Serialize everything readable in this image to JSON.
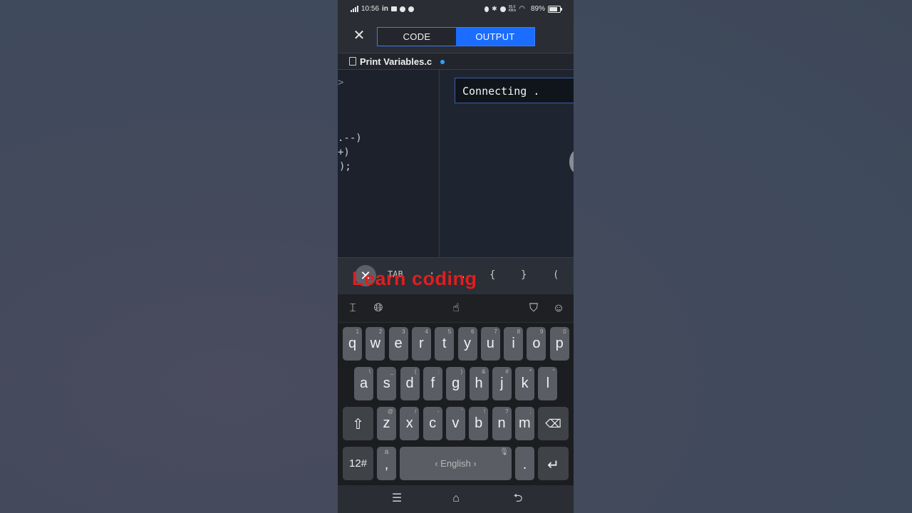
{
  "status_bar": {
    "time": "10:56",
    "app_badge": "in",
    "net_speed_top": "55.0",
    "net_speed_bottom": "KB/s",
    "battery": "89%"
  },
  "header": {
    "close_icon": "close-icon",
    "tabs": [
      {
        "label": "CODE",
        "active": false
      },
      {
        "label": "OUTPUT",
        "active": true
      }
    ]
  },
  "file": {
    "name": "Print Variables.c",
    "modified_dot_color": "#2aa4ff"
  },
  "code_pane": {
    "lines": [
      ">",
      ".--)",
      "+)",
      ");"
    ]
  },
  "output_pane": {
    "text": "Connecting ."
  },
  "helper_bar": {
    "keys": [
      "TAB",
      ";",
      ".",
      "{",
      "}",
      "("
    ],
    "overlay_caption": "Learn coding"
  },
  "keyboard": {
    "row1": [
      {
        "key": "q",
        "hint": "1"
      },
      {
        "key": "w",
        "hint": "2"
      },
      {
        "key": "e",
        "hint": "3"
      },
      {
        "key": "r",
        "hint": "4"
      },
      {
        "key": "t",
        "hint": "5"
      },
      {
        "key": "y",
        "hint": "6"
      },
      {
        "key": "u",
        "hint": "7"
      },
      {
        "key": "i",
        "hint": "8"
      },
      {
        "key": "o",
        "hint": "9"
      },
      {
        "key": "p",
        "hint": "0"
      }
    ],
    "row2": [
      {
        "key": "a",
        "hint": "\\"
      },
      {
        "key": "s",
        "hint": "_"
      },
      {
        "key": "d",
        "hint": "("
      },
      {
        "key": "f",
        "hint": ":"
      },
      {
        "key": "g",
        "hint": ")"
      },
      {
        "key": "h",
        "hint": "&"
      },
      {
        "key": "j",
        "hint": "#"
      },
      {
        "key": "k",
        "hint": "*"
      },
      {
        "key": "l",
        "hint": "\""
      }
    ],
    "row3": [
      {
        "key": "z",
        "hint": "@"
      },
      {
        "key": "x",
        "hint": "/"
      },
      {
        "key": "c",
        "hint": "-"
      },
      {
        "key": "v",
        "hint": "'"
      },
      {
        "key": "b",
        "hint": "!"
      },
      {
        "key": "n",
        "hint": "?"
      },
      {
        "key": "m",
        "hint": ";"
      }
    ],
    "numbers_key": "12#",
    "comma_key": ",",
    "comma_hint": "a",
    "space_label": "English",
    "period_key": ".",
    "accent_color": "#1a6dff"
  },
  "overlay_color": "#e01e1e"
}
